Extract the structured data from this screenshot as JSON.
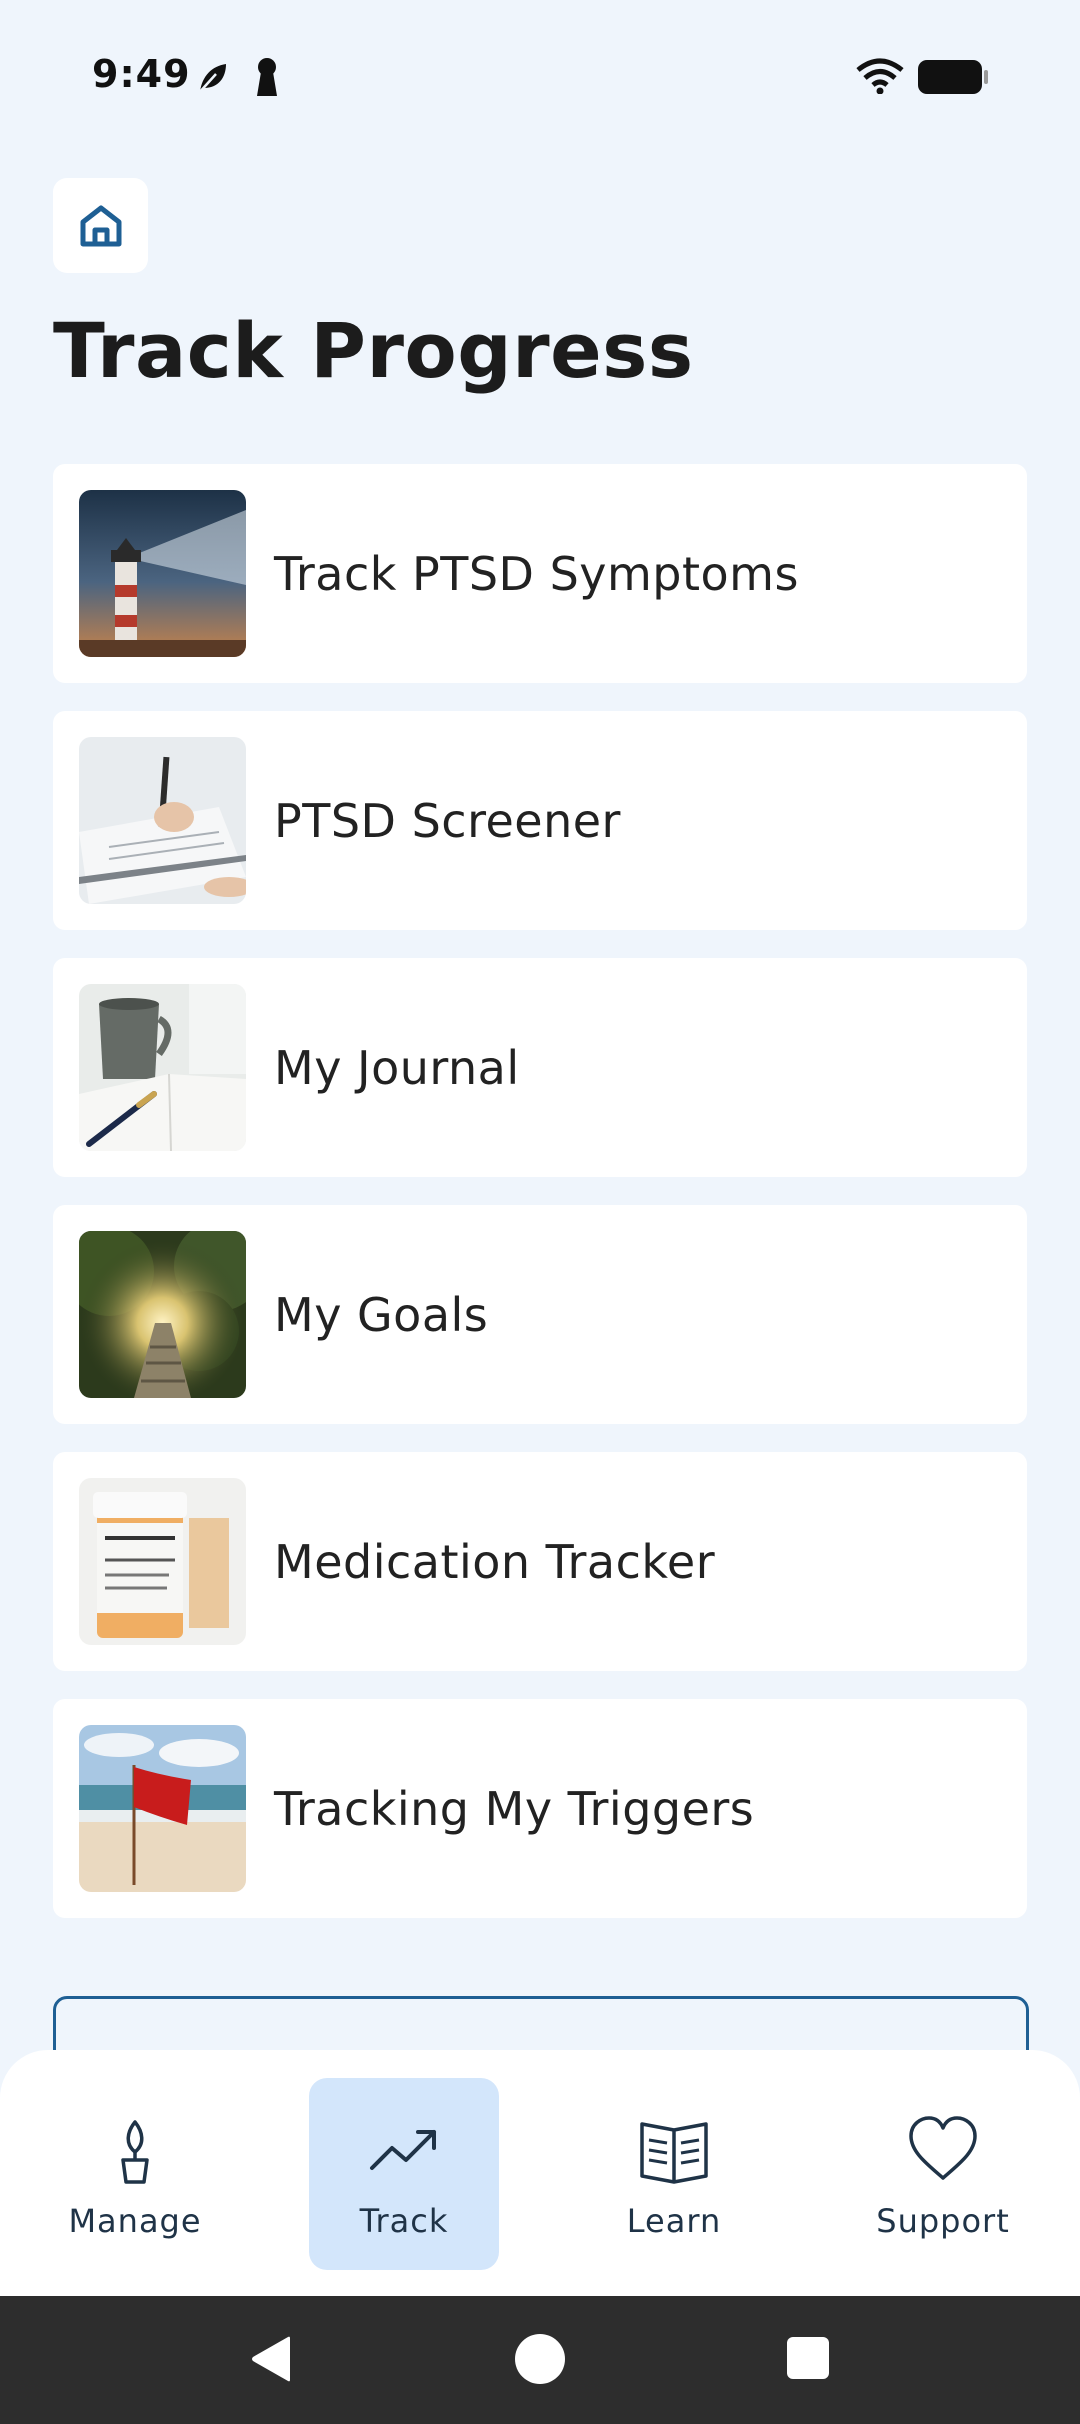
{
  "status_bar": {
    "time": "9:49",
    "icons": [
      "leaf-icon",
      "keyhole-icon",
      "wifi-icon",
      "battery-icon"
    ]
  },
  "header": {
    "home_icon": "home-icon",
    "title": "Track Progress"
  },
  "items": [
    {
      "label": "Track PTSD Symptoms",
      "image": "lighthouse-image"
    },
    {
      "label": "PTSD Screener",
      "image": "clipboard-writing-image"
    },
    {
      "label": "My Journal",
      "image": "mug-notebook-image"
    },
    {
      "label": "My Goals",
      "image": "forest-path-image"
    },
    {
      "label": "Medication Tracker",
      "image": "pill-bottles-image"
    },
    {
      "label": "Tracking My Triggers",
      "image": "red-flag-beach-image"
    }
  ],
  "bottom_nav": [
    {
      "label": "Manage",
      "icon": "plant-pot-icon",
      "active": false
    },
    {
      "label": "Track",
      "icon": "trend-chart-icon",
      "active": true
    },
    {
      "label": "Learn",
      "icon": "open-book-icon",
      "active": false
    },
    {
      "label": "Support",
      "icon": "heart-icon",
      "active": false
    }
  ],
  "colors": {
    "background": "#eff5fc",
    "card": "#ffffff",
    "accent": "#1e5f94",
    "active_tab": "#d3e6fb",
    "system_nav": "#2d2d2d"
  }
}
